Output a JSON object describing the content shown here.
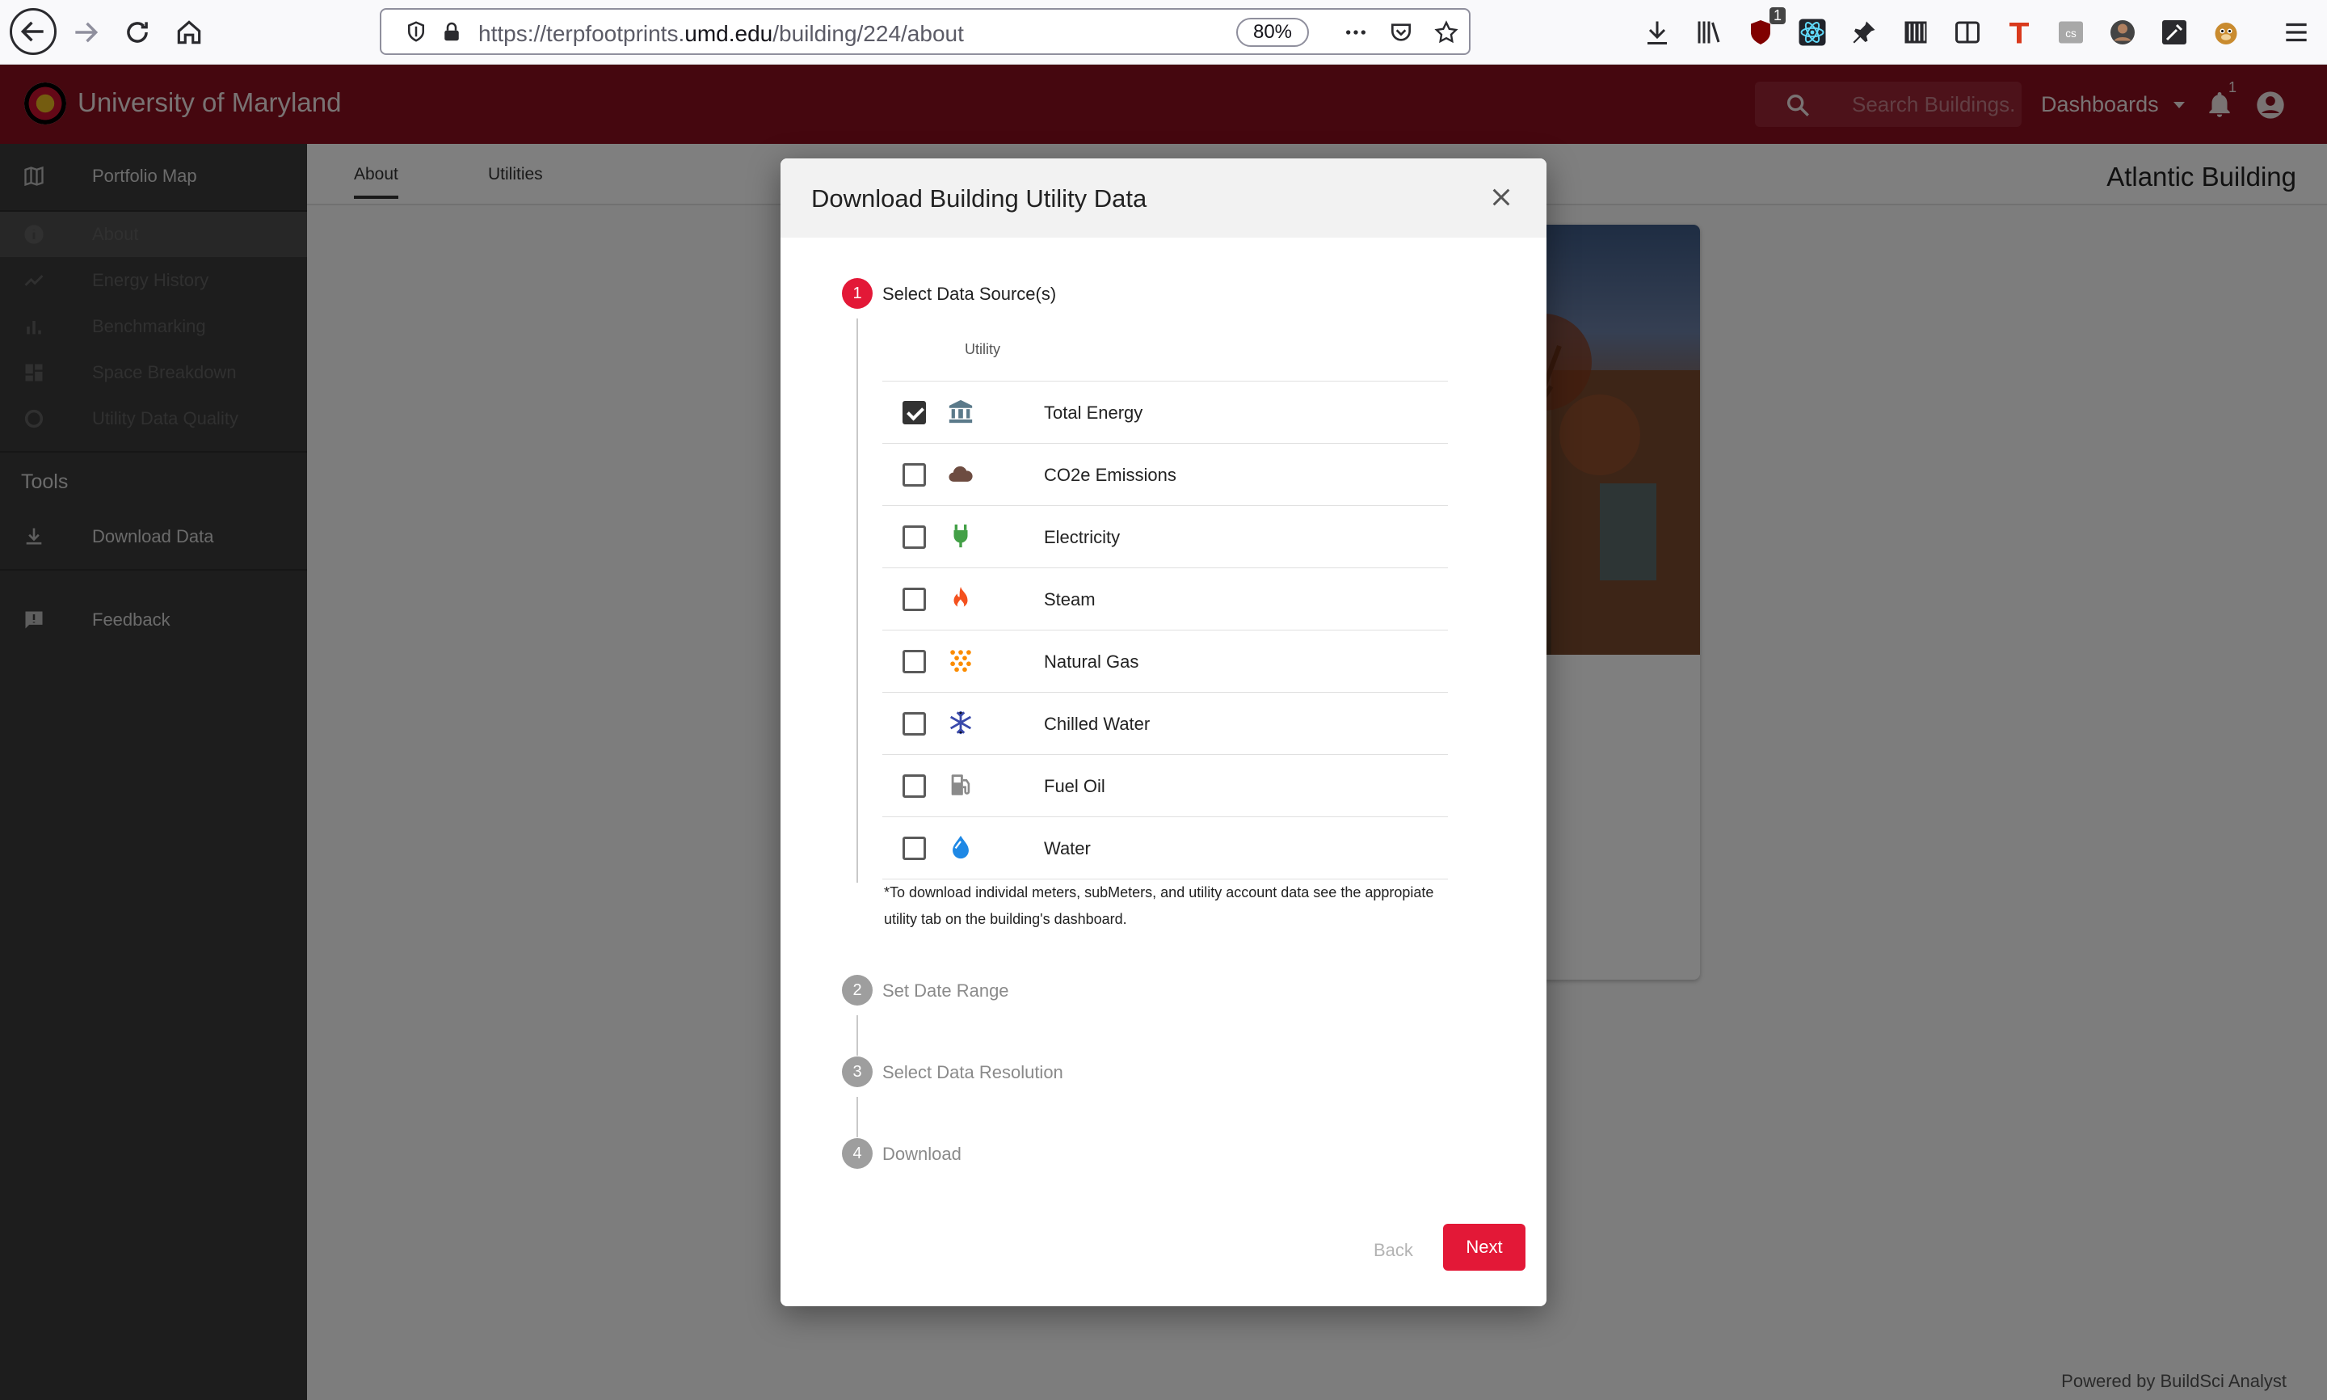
{
  "browser": {
    "url_prefix": "https://terpfootprints.",
    "url_domain": "umd.edu",
    "url_path": "/building/224/about",
    "zoom": "80%",
    "ublock_count": "1"
  },
  "header": {
    "brand": "University of Maryland",
    "search_placeholder": "Search Buildings...",
    "dashboards_label": "Dashboards",
    "notification_count": "1"
  },
  "sidebar": {
    "items": [
      {
        "label": "Portfolio Map",
        "icon": "map-icon"
      },
      {
        "label": "About",
        "icon": "info-icon"
      },
      {
        "label": "Energy History",
        "icon": "line-chart-icon"
      },
      {
        "label": "Benchmarking",
        "icon": "bar-chart-icon"
      },
      {
        "label": "Space Breakdown",
        "icon": "dashboard-grid-icon"
      },
      {
        "label": "Utility Data Quality",
        "icon": "ring-icon"
      }
    ],
    "tools_heading": "Tools",
    "download_label": "Download Data",
    "feedback_label": "Feedback"
  },
  "main": {
    "tabs": [
      {
        "label": "About"
      },
      {
        "label": "Utilities"
      }
    ],
    "building_title": "Atlantic Building",
    "powered_by": "Powered by BuildSci Analyst"
  },
  "modal": {
    "title": "Download Building Utility Data",
    "steps": [
      {
        "number": "1",
        "label": "Select Data Source(s)",
        "state": "active"
      },
      {
        "number": "2",
        "label": "Set Date Range",
        "state": "idle"
      },
      {
        "number": "3",
        "label": "Select Data Resolution",
        "state": "idle"
      },
      {
        "number": "4",
        "label": "Download",
        "state": "idle"
      }
    ],
    "utility_column_header": "Utility",
    "utilities": [
      {
        "label": "Total Energy",
        "icon": "bank-icon",
        "color": "#5b7a8a",
        "checked": true
      },
      {
        "label": "CO2e Emissions",
        "icon": "cloud-icon",
        "color": "#6d4c41",
        "checked": false
      },
      {
        "label": "Electricity",
        "icon": "plug-icon",
        "color": "#43a047",
        "checked": false
      },
      {
        "label": "Steam",
        "icon": "fire-icon",
        "color": "#f4511e",
        "checked": false
      },
      {
        "label": "Natural Gas",
        "icon": "gas-dots-icon",
        "color": "#fb8c00",
        "checked": false
      },
      {
        "label": "Chilled Water",
        "icon": "snowflake-icon",
        "color": "#3949ab",
        "checked": false
      },
      {
        "label": "Fuel Oil",
        "icon": "fuel-pump-icon",
        "color": "#8a8a8a",
        "checked": false
      },
      {
        "label": "Water",
        "icon": "water-drop-icon",
        "color": "#1e88e5",
        "checked": false
      }
    ],
    "footnote": "*To download individal meters, subMeters, and utility account data see the appropiate utility tab on the building's dashboard.",
    "back_label": "Back",
    "next_label": "Next"
  },
  "colors": {
    "brand_red": "#8a0f1f",
    "accent_red": "#e31837"
  }
}
